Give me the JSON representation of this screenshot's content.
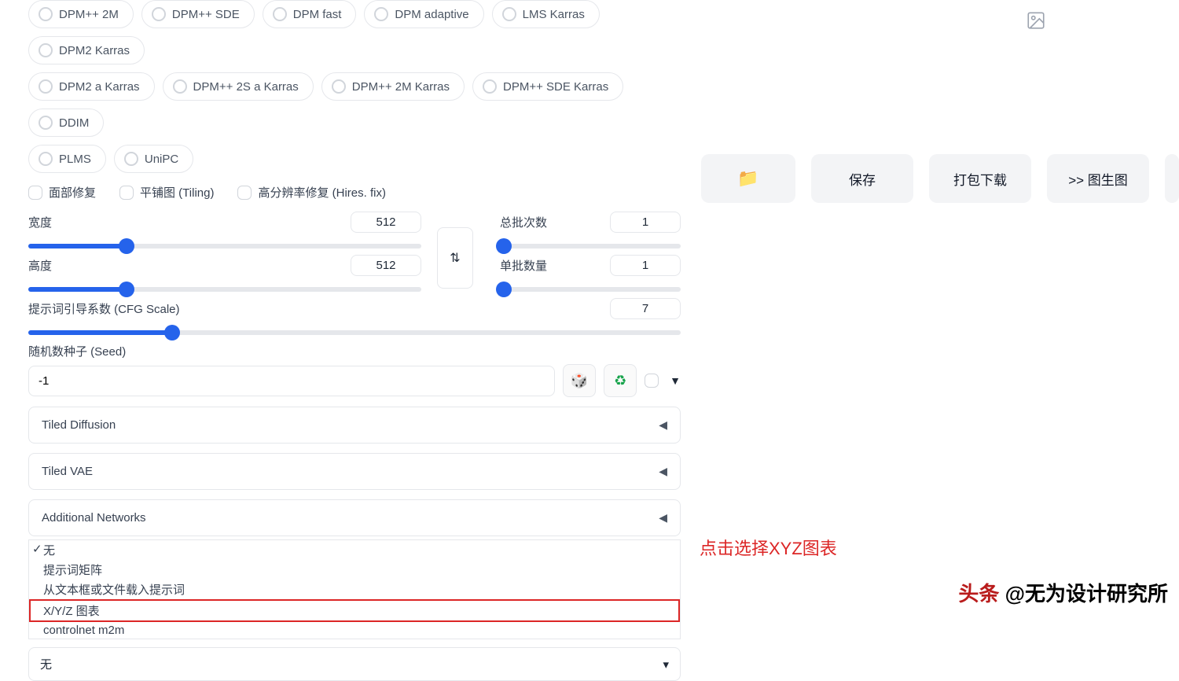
{
  "samplers_row1": [
    "DPM++ 2M",
    "DPM++ SDE",
    "DPM fast",
    "DPM adaptive",
    "LMS Karras",
    "DPM2 Karras"
  ],
  "samplers_row2": [
    "DPM2 a Karras",
    "DPM++ 2S a Karras",
    "DPM++ 2M Karras",
    "DPM++ SDE Karras",
    "DDIM"
  ],
  "samplers_row3": [
    "PLMS",
    "UniPC"
  ],
  "checks": {
    "face": "面部修复",
    "tiling": "平铺图 (Tiling)",
    "hires": "高分辨率修复 (Hires. fix)"
  },
  "width": {
    "label": "宽度",
    "value": "512",
    "pct": 25
  },
  "height": {
    "label": "高度",
    "value": "512",
    "pct": 25
  },
  "batch_count": {
    "label": "总批次数",
    "value": "1",
    "pct": 2
  },
  "batch_size": {
    "label": "单批数量",
    "value": "1",
    "pct": 2
  },
  "cfg": {
    "label": "提示词引导系数 (CFG Scale)",
    "value": "7",
    "pct": 22
  },
  "seed": {
    "label": "随机数种子 (Seed)",
    "value": "-1"
  },
  "accordions": [
    "Tiled Diffusion",
    "Tiled VAE",
    "Additional Networks"
  ],
  "script_options": {
    "selected": "无",
    "items": [
      "无",
      "提示词矩阵",
      "从文本框或文件载入提示词",
      "X/Y/Z 图表",
      "controlnet m2m"
    ]
  },
  "closed_select_value": "无",
  "annotation": "点击选择XYZ图表",
  "buttons": {
    "folder_icon": "📁",
    "save": "保存",
    "zip": "打包下载",
    "img2img": ">> 图生图"
  },
  "watermark": {
    "a": "头条",
    "b": " @无为设计研究所"
  },
  "icons": {
    "dice": "🎲",
    "recycle": "♻",
    "caret": "▼",
    "tri": "◀",
    "swap": "⇅",
    "dd": "▾"
  }
}
